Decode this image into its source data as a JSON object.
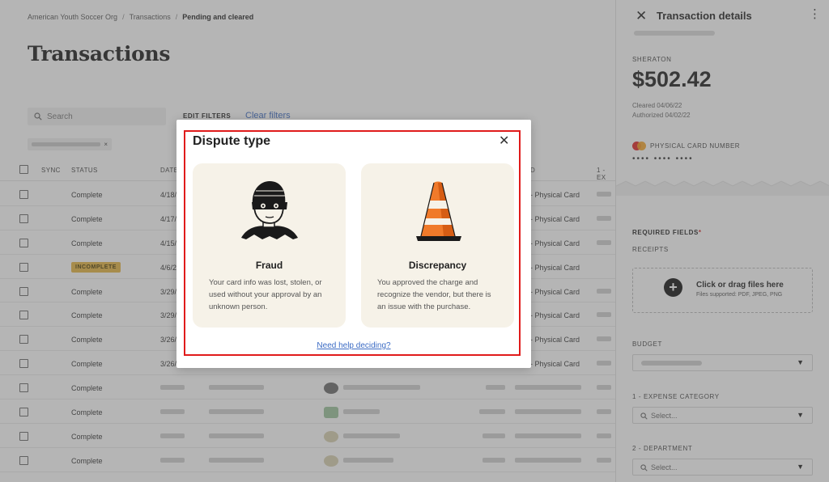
{
  "breadcrumb": {
    "org": "American Youth Soccer Org",
    "section": "Transactions",
    "current": "Pending and cleared",
    "sep": "/"
  },
  "page": {
    "title": "Transactions"
  },
  "search": {
    "placeholder": "Search"
  },
  "filters": {
    "edit_label": "EDIT FILTERS",
    "clear_label": "Clear filters"
  },
  "table": {
    "headers": {
      "sync": "SYNC",
      "status": "STATUS",
      "date": "DATE",
      "card_col": "D",
      "expense_col": "1 - EX"
    },
    "rows": [
      {
        "status": "Complete",
        "date": "4/18/",
        "card": "- Physical Card"
      },
      {
        "status": "Complete",
        "date": "4/17/",
        "card": "- Physical Card"
      },
      {
        "status": "Complete",
        "date": "4/15/",
        "card": "- Physical Card"
      },
      {
        "status": "INCOMPLETE",
        "date": "4/6/2",
        "card": "- Physical Card"
      },
      {
        "status": "Complete",
        "date": "3/29/",
        "card": "- Physical Card"
      },
      {
        "status": "Complete",
        "date": "3/29/",
        "card": "- Physical Card"
      },
      {
        "status": "Complete",
        "date": "3/26/",
        "card": "- Physical Card"
      },
      {
        "status": "Complete",
        "date": "3/26/",
        "card": "- Physical Card"
      },
      {
        "status": "Complete",
        "date": "",
        "card": ""
      },
      {
        "status": "Complete",
        "date": "",
        "card": ""
      },
      {
        "status": "Complete",
        "date": "",
        "card": ""
      },
      {
        "status": "Complete",
        "date": "",
        "card": ""
      }
    ]
  },
  "panel": {
    "title": "Transaction details",
    "merchant": "SHERATON",
    "amount": "$502.42",
    "cleared": "Cleared 04/06/22",
    "authorized": "Authorized 04/02/22",
    "card_label": "PHYSICAL CARD NUMBER",
    "card_dots": "••••  ••••  ••••",
    "required_label": "REQUIRED FIELDS",
    "required_star": "*",
    "receipts_label": "RECEIPTS",
    "dropzone_title": "Click or drag files here",
    "dropzone_sub": "Files supported: PDF, JPEG, PNG",
    "budget_label": "BUDGET",
    "expense_label": "1 - EXPENSE CATEGORY",
    "expense_placeholder": "Select...",
    "department_label": "2 - DEPARTMENT",
    "department_placeholder": "Select..."
  },
  "modal": {
    "title": "Dispute type",
    "options": [
      {
        "title": "Fraud",
        "description": "Your card info was lost, stolen, or used without your approval by an unknown person.",
        "icon": "masked-thief-icon"
      },
      {
        "title": "Discrepancy",
        "description": "You approved the charge and recognize the vendor, but there is an issue with the purchase.",
        "icon": "traffic-cone-icon"
      }
    ],
    "help_link": "Need help deciding?"
  },
  "colors": {
    "highlight": "#e01b1b",
    "link": "#3b6bc4",
    "option_bg": "#f6f2e8",
    "badge": "#e6b441"
  }
}
